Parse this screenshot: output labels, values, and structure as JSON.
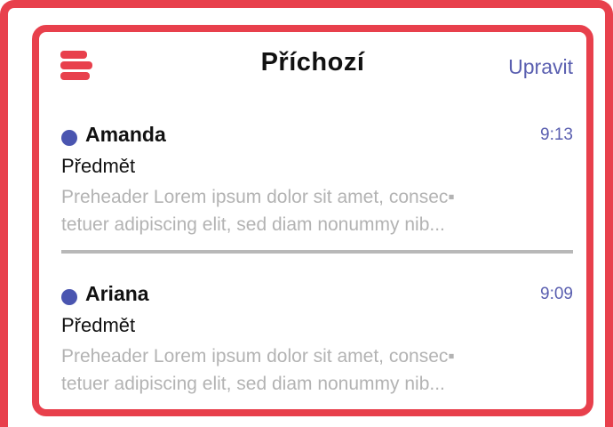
{
  "header": {
    "title": "Příchozí",
    "edit_label": "Upravit",
    "menu_icon": "hamburger-menu-icon",
    "accent_color": "#e8404c",
    "link_color": "#5a5fb0"
  },
  "messages": [
    {
      "sender": "Amanda",
      "time": "9:13",
      "subject": "Předmět",
      "preview_line1": "Preheader Lorem ipsum dolor sit amet, consec▪",
      "preview_line2": "tetuer adipiscing elit, sed diam nonummy nib...",
      "unread": true
    },
    {
      "sender": "Ariana",
      "time": "9:09",
      "subject": "Předmět",
      "preview_line1": "Preheader Lorem ipsum dolor sit amet, consec▪",
      "preview_line2": "tetuer adipiscing elit, sed diam nonummy nib...",
      "unread": true
    }
  ]
}
